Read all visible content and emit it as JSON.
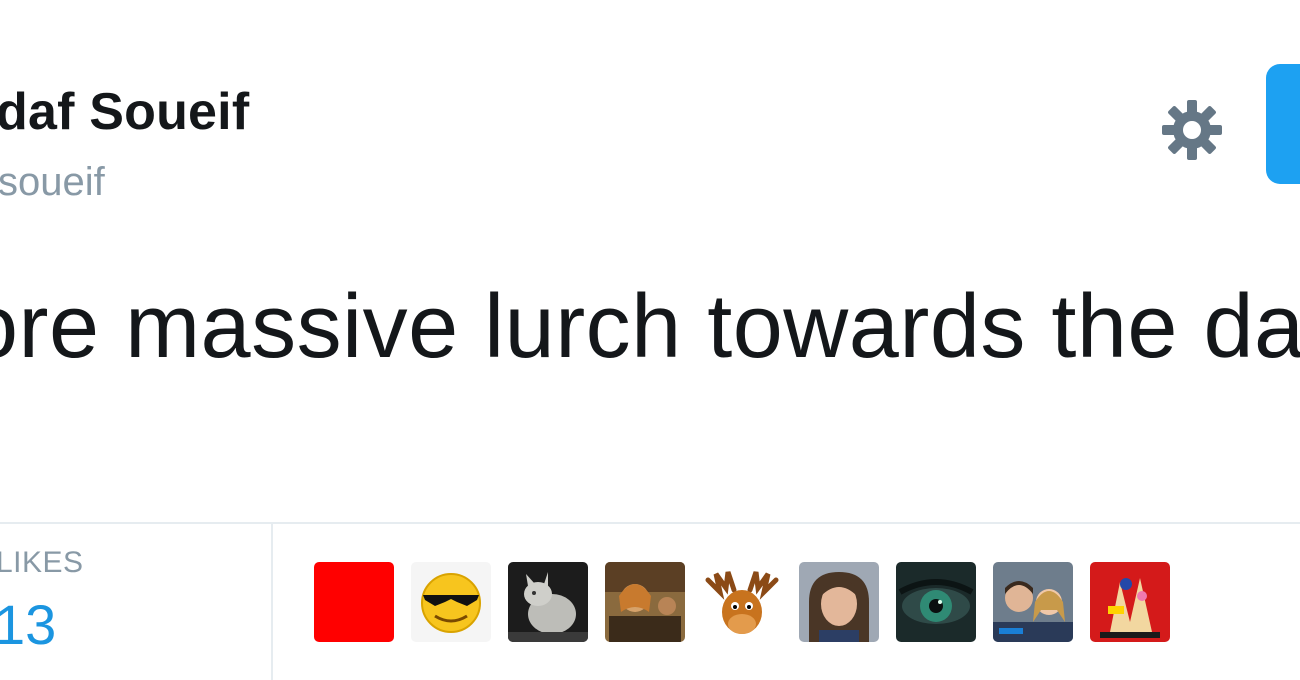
{
  "tweet": {
    "display_name": "daf Soueif",
    "handle": "soueif",
    "text": "ore massive lurch towards the da"
  },
  "stats": {
    "likes_label": "LIKES",
    "likes_count": "13"
  },
  "likers": [
    {
      "name": "liker-avatar-1",
      "style": "red-square"
    },
    {
      "name": "liker-avatar-2",
      "style": "sunglasses-smiley"
    },
    {
      "name": "liker-avatar-3",
      "style": "cat-photo"
    },
    {
      "name": "liker-avatar-4",
      "style": "group-photo"
    },
    {
      "name": "liker-avatar-5",
      "style": "moose-cartoon"
    },
    {
      "name": "liker-avatar-6",
      "style": "woman-portrait"
    },
    {
      "name": "liker-avatar-7",
      "style": "eye-closeup"
    },
    {
      "name": "liker-avatar-8",
      "style": "couple-photo"
    },
    {
      "name": "liker-avatar-9",
      "style": "red-artwork"
    }
  ],
  "colors": {
    "accent": "#1da1f2",
    "likes_count": "#1b95e0",
    "text": "#14171a",
    "muted": "#8899a6",
    "divider": "#e6ecf0"
  },
  "icons": {
    "settings": "gear-icon"
  }
}
